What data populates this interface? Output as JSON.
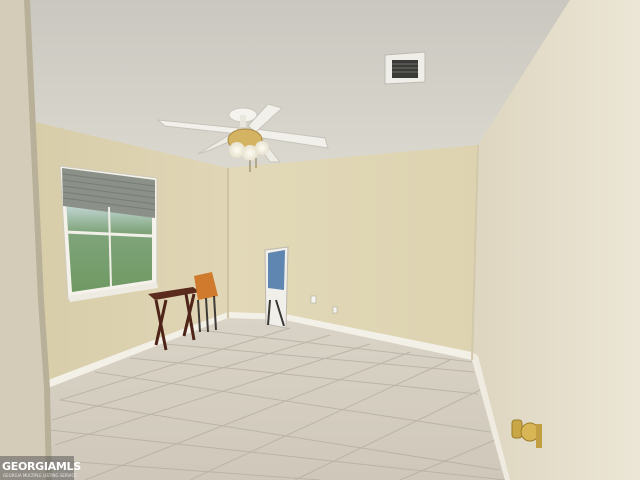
{
  "photo": {
    "scene": "empty-bedroom-with-tile-floor",
    "colors": {
      "ceiling": "#d4d1c8",
      "left_wall": "#ddd3b2",
      "back_wall": "#e0d7b6",
      "right_wall": "#e6dfcc",
      "tile_floor": "#d6d0c3",
      "grout": "#b9b2a4",
      "baseboard": "#f2efe6",
      "window_glass": "#8fb48a",
      "blind": "#8a8f86",
      "table_wood": "#5a2a1c"
    }
  },
  "watermark": {
    "brand": "GEORGIAMLS",
    "tagline": "GEORGIA MULTIPLE LISTING SERVICE"
  }
}
